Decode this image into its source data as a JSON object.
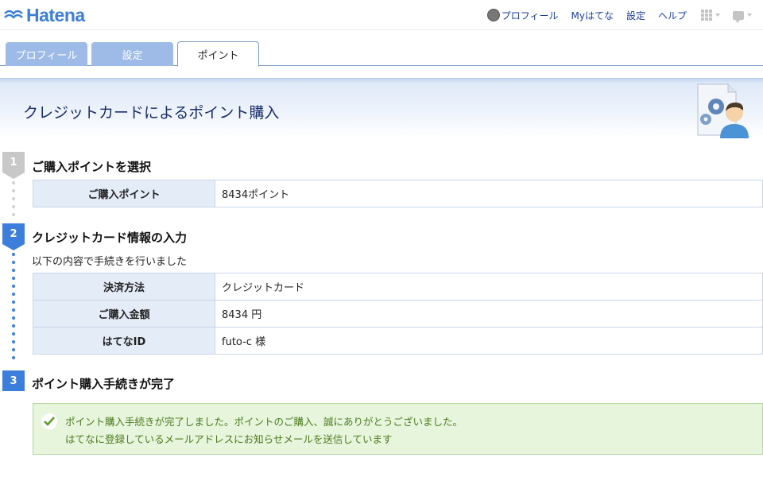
{
  "header": {
    "logo_text": "Hatena",
    "nav": {
      "profile": "プロフィール",
      "my_hatena": "Myはてな",
      "settings": "設定",
      "help": "ヘルプ"
    }
  },
  "tabs": [
    {
      "label": "プロフィール",
      "active": false
    },
    {
      "label": "設定",
      "active": false
    },
    {
      "label": "ポイント",
      "active": true
    }
  ],
  "page": {
    "title": "クレジットカードによるポイント購入"
  },
  "steps": [
    {
      "number": "1",
      "title": "ご購入ポイントを選択",
      "rows": [
        {
          "key": "ご購入ポイント",
          "value": "8434ポイント"
        }
      ]
    },
    {
      "number": "2",
      "title": "クレジットカード情報の入力",
      "description": "以下の内容で手続きを行いました",
      "rows": [
        {
          "key": "決済方法",
          "value": "クレジットカード"
        },
        {
          "key": "ご購入金額",
          "value": "8434 円"
        },
        {
          "key": "はてなID",
          "value": "futo-c 様"
        }
      ]
    },
    {
      "number": "3",
      "title": "ポイント購入手続きが完了"
    }
  ],
  "success": {
    "line1": "ポイント購入手続きが完了しました。ポイントのご購入、誠にありがとうございました。",
    "line2": "はてなに登録しているメールアドレスにお知らせメールを送信しています"
  },
  "colors": {
    "accent_blue": "#3c7edc",
    "step_done_grey": "#c8c8c8",
    "tab_inactive": "#9dbbe6",
    "success_bg": "#e6f5dc",
    "success_text": "#4c7a1e"
  }
}
